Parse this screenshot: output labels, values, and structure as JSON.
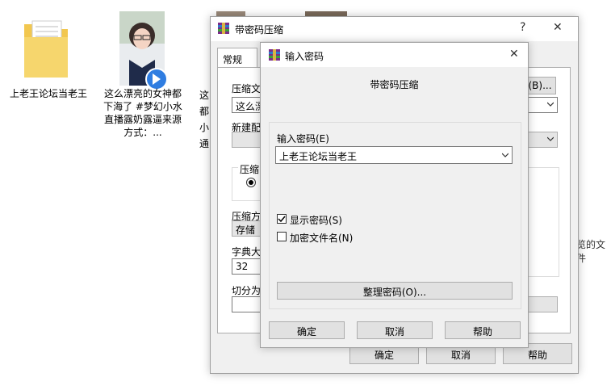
{
  "desktop": {
    "folder_label": "上老王论坛当老王",
    "video_label": "这么漂亮的女神都下海了 #梦幻小水 直播露奶露逼来源方式：...",
    "partial_label": "这都小通",
    "side_text": "览的文件"
  },
  "back_window": {
    "title": "带密码压缩",
    "help_btn": "?",
    "close_btn": "✕",
    "tab_general": "常规",
    "archive_label": "压缩文",
    "archive_value": "这么漂",
    "browse_btn": "(B)...",
    "new_config_label": "新建配",
    "format_group_label": "压缩",
    "method_label": "压缩方",
    "method_value": "存储",
    "dict_label": "字典大",
    "dict_value": "32",
    "split_label": "切分为",
    "ok": "确定",
    "cancel": "取消",
    "help": "帮助"
  },
  "password_dialog": {
    "title": "输入密码",
    "close_btn": "✕",
    "heading": "带密码压缩",
    "enter_label": "输入密码(E)",
    "password_value": "上老王论坛当老王",
    "show_password_label": "显示密码(S)",
    "show_password_checked": true,
    "encrypt_names_label": "加密文件名(N)",
    "encrypt_names_checked": false,
    "organize_btn": "整理密码(O)...",
    "ok": "确定",
    "cancel": "取消",
    "help": "帮助"
  }
}
